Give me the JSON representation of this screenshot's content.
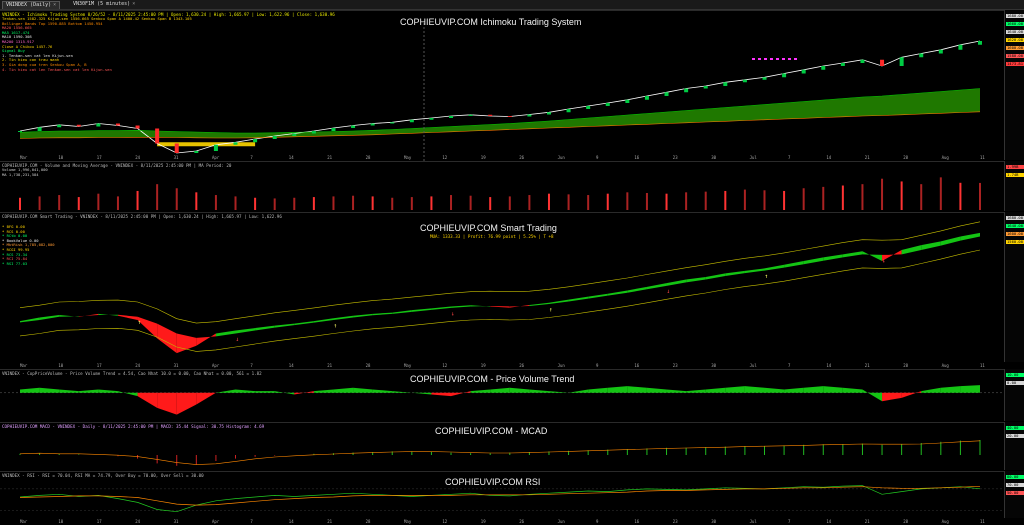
{
  "tabs": [
    {
      "label": "VNINDEX (Daily)",
      "active": true
    },
    {
      "label": "VN30F1M (5 minutes)",
      "active": false
    }
  ],
  "panel1": {
    "title": "COPHIEUVIP.COM Ichimoku Trading System",
    "info_line": "VNINDEX - Ichimoku Trading System 8/26/52 - 8/11/2025 2:45:00 PM | Open: 1,630.24 | High: 1,665.97 | Low: 1,622.96 | Close: 1,630.96",
    "notes": [
      "Tenkan-sen 1582.325  Kijun-sen 1556.665  Senkou Span A 1400.42  Senkou Span B 1343.105",
      "Bollinger Bands Top 1590.885  Bottom 1450.954",
      "MA20 1556.665",
      "MA5  1617.474",
      "MA10 1590.308",
      "MA200 1315.917",
      "Close A Chikou 1457.76",
      "Signal Buy",
      "1. Tenkan-sen cat len Kijun-sen",
      "2. Tin hieu con trau manh",
      "3. Gia dong cua tren Senkou Span A, B",
      "4. Tin hieu cat len Tenkan-sen cat len Kijun-sen"
    ],
    "axis_labels": [
      {
        "text": "1680.00",
        "color": "#d8d8d8"
      },
      {
        "text": "1660.00",
        "color": "#00ff66"
      },
      {
        "text": "1640.00",
        "color": "#d8d8d8"
      },
      {
        "text": "1620.00",
        "color": "#ffd400"
      },
      {
        "text": "1600.00",
        "color": "#ff9a33"
      },
      {
        "text": "1580.00",
        "color": "#ff5555"
      },
      {
        "text": "1473.81",
        "color": "#ff3b3b"
      }
    ]
  },
  "xaxis": {
    "labels": [
      "Mar",
      "10",
      "17",
      "24",
      "31",
      "Apr",
      "7",
      "14",
      "21",
      "28",
      "May",
      "12",
      "19",
      "26",
      "Jun",
      "9",
      "16",
      "23",
      "30",
      "Jul",
      "7",
      "14",
      "21",
      "28",
      "Aug",
      "11"
    ]
  },
  "panel2": {
    "title": "",
    "info_line": "COPHIEUVIP.COM - Volume and Moving Average - VNINDEX - 8/11/2025 2:45:00 PM | MA Period: 20",
    "notes": [
      "Volume 1,996,041,000",
      "MA 1,738,231,584"
    ],
    "axis_labels": [
      {
        "text": "1.99B",
        "color": "#ff4444"
      },
      {
        "text": "1.74B",
        "color": "#ffd400"
      }
    ]
  },
  "panel3": {
    "title": "COPHIEUVIP.COM Smart Trading",
    "subtitle": "MUA: 1333.33 | Profit: 76.99 point | 5.25% | T +8",
    "info_line": "COPHIEUVIP.COM Smart Trading - VNINDEX - 8/11/2025 2:45:00 PM | Open: 1,630.24 | High: 1,665.97 | Low: 1,622.96",
    "notes": [
      "* BFG   0.00",
      "* RCS   0.00",
      "* RCtb  0.00",
      "* BookValue 0.00",
      "* MktRisk  1,785,082,000",
      "* RCGI  99.95",
      "* RCS   73.34",
      "* RCI   75.84",
      "* RSI   77.03"
    ],
    "axis_labels": [
      {
        "text": "1680.00",
        "color": "#d8d8d8"
      },
      {
        "text": "1640.00",
        "color": "#00ff66"
      },
      {
        "text": "1600.00",
        "color": "#ff9a33"
      },
      {
        "text": "1560.00",
        "color": "#ffd400"
      }
    ]
  },
  "panel4": {
    "title": "COPHIEUVIP.COM - Price Volume Trend",
    "info_line": "VNINDEX - CopPriceVolume - Price Volume Trend = 4.54, Cao Nhat 10.0 = 0.00, Cao Nhat = 0.00, 561 = 1.82",
    "axis_labels": [
      {
        "text": "10.00",
        "color": "#00ff66"
      },
      {
        "text": "0.00",
        "color": "#d8d8d8"
      }
    ]
  },
  "panel5": {
    "title": "COPHIEUVIP.COM - MCAD",
    "info_line": "COPHIEUVIP.COM MACD - VNINDEX - Daily - 8/11/2025 2:45:00 PM | MACD: 35.44 Signal: 30.75 Histogram: 4.69",
    "axis_labels": [
      {
        "text": "40.00",
        "color": "#00ff66"
      },
      {
        "text": "20.00",
        "color": "#d8d8d8"
      }
    ]
  },
  "panel6": {
    "title": "COPHIEUVIP.COM RSI",
    "info_line": "VNINDEX - RSI - RSI = 70.04, RSI MA = 74.79, Over Buy = 70.00, Over Sell = 30.00",
    "axis_labels": [
      {
        "text": "80.00",
        "color": "#00ff66"
      },
      {
        "text": "70.00",
        "color": "#d8d8d8"
      },
      {
        "text": "50.00",
        "color": "#ff5555"
      }
    ]
  },
  "chart_data": [
    {
      "type": "line",
      "name": "Ichimoku price panel",
      "series": [
        {
          "name": "Close",
          "color": "#ffffff",
          "values": [
            1300,
            1315,
            1325,
            1318,
            1330,
            1322,
            1310,
            1250,
            1212,
            1220,
            1245,
            1255,
            1268,
            1280,
            1290,
            1300,
            1312,
            1322,
            1330,
            1335,
            1345,
            1352,
            1360,
            1365,
            1360,
            1358,
            1366,
            1375,
            1388,
            1400,
            1412,
            1425,
            1440,
            1455,
            1470,
            1480,
            1495,
            1505,
            1515,
            1530,
            1545,
            1560,
            1572,
            1585,
            1560,
            1595,
            1610,
            1625,
            1645,
            1660
          ]
        },
        {
          "name": "Senkou Span A",
          "color": "#00c000",
          "values": [
            1295,
            1298,
            1300,
            1300,
            1302,
            1302,
            1303,
            1300,
            1298,
            1296,
            1294,
            1292,
            1292,
            1293,
            1295,
            1296,
            1298,
            1300,
            1303,
            1306,
            1310,
            1314,
            1318,
            1322,
            1326,
            1330,
            1335,
            1340,
            1346,
            1352,
            1358,
            1364,
            1370,
            1376,
            1382,
            1388,
            1394,
            1400,
            1406,
            1412,
            1418,
            1424,
            1430,
            1436,
            1440,
            1446,
            1452,
            1458,
            1464,
            1470
          ]
        },
        {
          "name": "Senkou Span B",
          "color": "#ff7700",
          "values": [
            1270,
            1272,
            1273,
            1273,
            1274,
            1274,
            1275,
            1275,
            1274,
            1273,
            1272,
            1272,
            1273,
            1275,
            1277,
            1279,
            1281,
            1283,
            1285,
            1288,
            1291,
            1294,
            1297,
            1300,
            1303,
            1306,
            1309,
            1312,
            1315,
            1318,
            1321,
            1324,
            1327,
            1330,
            1333,
            1336,
            1339,
            1342,
            1345,
            1348,
            1351,
            1354,
            1357,
            1360,
            1362,
            1365,
            1368,
            1371,
            1374,
            1377
          ]
        }
      ],
      "ylim": [
        1200,
        1700
      ]
    },
    {
      "type": "bar",
      "name": "Volume",
      "values": [
        0.9,
        1.0,
        1.1,
        0.95,
        1.2,
        1.0,
        1.4,
        1.9,
        1.6,
        1.3,
        1.1,
        1.0,
        0.9,
        0.85,
        0.9,
        0.95,
        1.0,
        1.05,
        1.0,
        0.9,
        0.95,
        1.0,
        1.1,
        1.05,
        0.95,
        1.0,
        1.1,
        1.2,
        1.15,
        1.1,
        1.2,
        1.3,
        1.25,
        1.2,
        1.3,
        1.35,
        1.4,
        1.5,
        1.45,
        1.4,
        1.6,
        1.7,
        1.8,
        1.9,
        2.3,
        2.1,
        1.9,
        2.4,
        2.0,
        1.99
      ],
      "ylim": [
        0,
        2.5
      ]
    },
    {
      "type": "area",
      "name": "Smart Trading band",
      "series": [
        {
          "name": "Fast",
          "values": [
            1300,
            1315,
            1325,
            1318,
            1330,
            1322,
            1305,
            1230,
            1170,
            1200,
            1250,
            1262,
            1272,
            1282,
            1290,
            1300,
            1312,
            1322,
            1330,
            1335,
            1345,
            1352,
            1360,
            1365,
            1360,
            1355,
            1366,
            1375,
            1388,
            1400,
            1412,
            1425,
            1440,
            1455,
            1470,
            1480,
            1495,
            1505,
            1515,
            1530,
            1545,
            1560,
            1572,
            1585,
            1545,
            1590,
            1610,
            1625,
            1645,
            1660
          ]
        },
        {
          "name": "Slow",
          "values": [
            1295,
            1305,
            1318,
            1320,
            1325,
            1326,
            1318,
            1290,
            1250,
            1232,
            1238,
            1250,
            1262,
            1274,
            1284,
            1294,
            1305,
            1315,
            1324,
            1330,
            1338,
            1346,
            1354,
            1360,
            1362,
            1360,
            1362,
            1370,
            1380,
            1392,
            1404,
            1416,
            1430,
            1444,
            1458,
            1470,
            1484,
            1496,
            1506,
            1518,
            1532,
            1546,
            1560,
            1572,
            1570,
            1572,
            1590,
            1608,
            1628,
            1645
          ]
        }
      ],
      "ylim": [
        1150,
        1700
      ]
    },
    {
      "type": "area",
      "name": "Price Volume Trend",
      "values": [
        2,
        3,
        2,
        1,
        2,
        1,
        -2,
        -9,
        -13,
        -7,
        0,
        2,
        1,
        1,
        -1,
        1,
        2,
        3,
        2,
        1,
        0,
        -1,
        -2,
        1,
        2,
        3,
        2,
        1,
        0,
        2,
        3,
        4,
        3,
        2,
        1,
        2,
        3,
        4,
        3,
        2,
        3,
        4,
        3,
        2,
        -5,
        -3,
        1,
        3,
        4,
        4.54
      ],
      "ylim": [
        -15,
        10
      ]
    },
    {
      "type": "bar",
      "name": "MACD",
      "values": [
        2,
        3,
        2,
        1,
        0,
        -2,
        -6,
        -14,
        -18,
        -16,
        -10,
        -6,
        -3,
        -1,
        0,
        2,
        3,
        4,
        5,
        6,
        6,
        5,
        4,
        3,
        3,
        4,
        5,
        6,
        7,
        8,
        9,
        10,
        11,
        12,
        12,
        13,
        14,
        15,
        15,
        16,
        17,
        18,
        18,
        19,
        17,
        18,
        20,
        22,
        24,
        25
      ],
      "ylim": [
        -20,
        40
      ]
    },
    {
      "type": "line",
      "name": "RSI",
      "series": [
        {
          "name": "RSI",
          "values": [
            55,
            58,
            60,
            56,
            58,
            52,
            45,
            32,
            28,
            40,
            48,
            52,
            55,
            58,
            56,
            58,
            60,
            62,
            60,
            58,
            56,
            58,
            60,
            62,
            58,
            57,
            60,
            62,
            64,
            66,
            65,
            68,
            70,
            69,
            68,
            70,
            72,
            71,
            70,
            72,
            74,
            73,
            75,
            76,
            60,
            65,
            70,
            72,
            74,
            70.04
          ]
        },
        {
          "name": "RSI MA",
          "values": [
            54,
            55,
            56,
            57,
            57,
            56,
            54,
            48,
            42,
            40,
            41,
            44,
            47,
            50,
            52,
            54,
            55,
            57,
            58,
            58,
            58,
            58,
            58,
            59,
            59,
            59,
            59,
            60,
            61,
            62,
            63,
            64,
            66,
            67,
            67,
            68,
            69,
            70,
            70,
            71,
            72,
            72,
            73,
            74,
            72,
            71,
            71,
            72,
            73,
            74.79
          ]
        }
      ],
      "ylim": [
        20,
        90
      ]
    }
  ]
}
